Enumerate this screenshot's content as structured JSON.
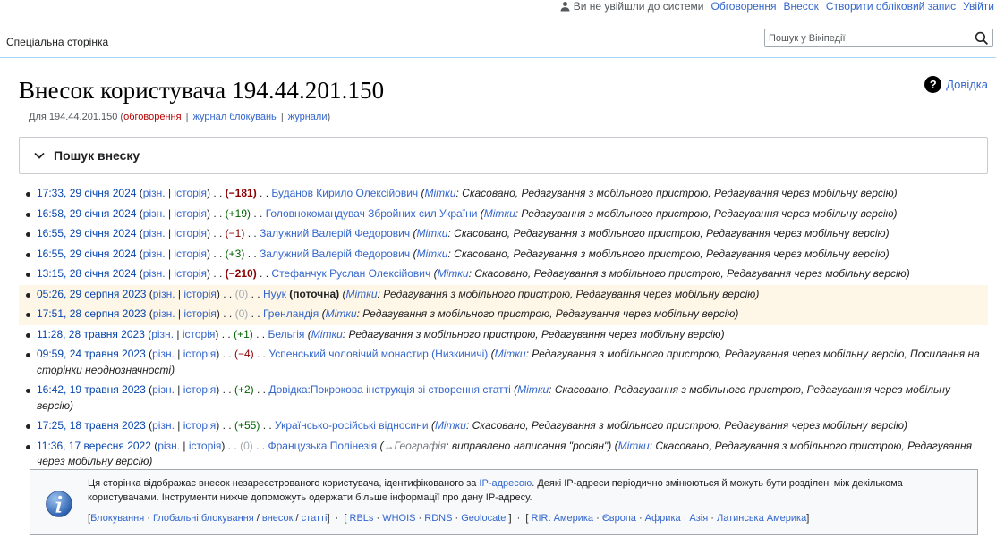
{
  "personal": {
    "anon": "Ви не увійшли до системи",
    "links": [
      "Обговорення",
      "Внесок",
      "Створити обліковий запис",
      "Увійти"
    ]
  },
  "tabs": {
    "special": "Спеціальна сторінка"
  },
  "search": {
    "placeholder": "Пошук у Вікіпедії"
  },
  "page": {
    "title": "Внесок користувача 194.44.201.150",
    "help": "Довідка",
    "sub_prefix": "Для 194.44.201.150 (",
    "sub_talk": "обговорення",
    "sub_block": "журнал блокувань",
    "sub_logs": "журнали",
    "sub_suffix": ")",
    "sep": "|"
  },
  "searchpanel": {
    "label": "Пошук внеску"
  },
  "contribs": [
    {
      "time": "17:33, 29 січня 2024",
      "diff": "різн.",
      "hist": "історія",
      "size": "(−181)",
      "size_class": "diff-neg-big",
      "page": "Буданов Кирило Олексійович",
      "current": "",
      "comment": "",
      "tags_label": "Мітки",
      "tags": "Скасовано, Редагування з мобільного пристрою, Редагування через мобільну версію"
    },
    {
      "time": "16:58, 29 січня 2024",
      "diff": "різн.",
      "hist": "історія",
      "size": "(+19)",
      "size_class": "diff-pos",
      "page": "Головнокомандувач Збройних сил України",
      "current": "",
      "comment": "",
      "tags_label": "Мітки",
      "tags": "Редагування з мобільного пристрою, Редагування через мобільну версію"
    },
    {
      "time": "16:55, 29 січня 2024",
      "diff": "різн.",
      "hist": "історія",
      "size": "(−1)",
      "size_class": "diff-neg",
      "page": "Залужний Валерій Федорович",
      "current": "",
      "comment": "",
      "tags_label": "Мітки",
      "tags": "Скасовано, Редагування з мобільного пристрою, Редагування через мобільну версію"
    },
    {
      "time": "16:55, 29 січня 2024",
      "diff": "різн.",
      "hist": "історія",
      "size": "(+3)",
      "size_class": "diff-pos",
      "page": "Залужний Валерій Федорович",
      "current": "",
      "comment": "",
      "tags_label": "Мітки",
      "tags": "Скасовано, Редагування з мобільного пристрою, Редагування через мобільну версію"
    },
    {
      "time": "13:15, 28 січня 2024",
      "diff": "різн.",
      "hist": "історія",
      "size": "(−210)",
      "size_class": "diff-neg-big",
      "page": "Стефанчук Руслан Олексійович",
      "current": "",
      "comment": "",
      "tags_label": "Мітки",
      "tags": "Скасовано, Редагування з мобільного пристрою, Редагування через мобільну версію"
    },
    {
      "time": "05:26, 29 серпня 2023",
      "diff": "різн.",
      "hist": "історія",
      "size": "(0)",
      "size_class": "diff-zero",
      "page": "Нуук",
      "current": "(поточна)",
      "comment": "",
      "tags_label": "Мітки",
      "tags": "Редагування з мобільного пристрою, Редагування через мобільну версію",
      "highlight": true
    },
    {
      "time": "17:51, 28 серпня 2023",
      "diff": "різн.",
      "hist": "історія",
      "size": "(0)",
      "size_class": "diff-zero",
      "page": "Гренландія",
      "current": "",
      "comment": "",
      "tags_label": "Мітки",
      "tags": "Редагування з мобільного пристрою, Редагування через мобільну версію",
      "highlight": true
    },
    {
      "time": "11:28, 28 травня 2023",
      "diff": "різн.",
      "hist": "історія",
      "size": "(+1)",
      "size_class": "diff-pos",
      "page": "Бельгія",
      "current": "",
      "comment": "",
      "tags_label": "Мітки",
      "tags": "Редагування з мобільного пристрою, Редагування через мобільну версію"
    },
    {
      "time": "09:59, 24 травня 2023",
      "diff": "різн.",
      "hist": "історія",
      "size": "(−4)",
      "size_class": "diff-neg",
      "page": "Успенський чоловічий монастир (Низкиничі)",
      "current": "",
      "comment": "",
      "tags_label": "Мітки",
      "tags": "Редагування з мобільного пристрою, Редагування через мобільну версію, Посилання на сторінки неоднозначності"
    },
    {
      "time": "16:42, 19 травня 2023",
      "diff": "різн.",
      "hist": "історія",
      "size": "(+2)",
      "size_class": "diff-pos",
      "page": "Довідка:Покрокова інструкція зі створення статті",
      "current": "",
      "comment": "",
      "tags_label": "Мітки",
      "tags": "Скасовано, Редагування з мобільного пристрою, Редагування через мобільну версію"
    },
    {
      "time": "17:25, 18 травня 2023",
      "diff": "різн.",
      "hist": "історія",
      "size": "(+55)",
      "size_class": "diff-pos",
      "page": "Українсько-російські відносини",
      "current": "",
      "comment": "",
      "tags_label": "Мітки",
      "tags": "Скасовано, Редагування з мобільного пристрою, Редагування через мобільну версію"
    },
    {
      "time": "11:36, 17 вересня 2022",
      "diff": "різн.",
      "hist": "історія",
      "size": "(0)",
      "size_class": "diff-zero",
      "page": "Французька Полінезія",
      "current": "",
      "comment_arrow": "→Географія",
      "comment": ": виправлено написання \"росіян\"",
      "tags_label": "Мітки",
      "tags": "Скасовано, Редагування з мобільного пристрою, Редагування через мобільну версію"
    }
  ],
  "common": {
    "dots": ". .",
    "sepbar": "|"
  },
  "infobox": {
    "text1": "Ця сторінка відображає внесок незареєстрованого користувача, ідентифікованого за ",
    "ip_link": "IP-адресою",
    "text2": ". Деякі IP-адреси періодично змінюються й можуть бути розділені між декількома користувачами. Інструменти нижче допоможуть одержати більше інформації про дану IP-адресу.",
    "tools": {
      "block": "Блокування",
      "global_block": "Глобальні блокування",
      "contribs": "внесок",
      "articles": "статті",
      "rbls": "RBLs",
      "whois": "WHOIS",
      "rdns": "RDNS",
      "geolocate": "Geolocate",
      "rir": "RIR",
      "america": "Америка",
      "europe": "Європа",
      "africa": "Африка",
      "asia": "Азія",
      "latam": "Латинська Америка"
    }
  },
  "colors": {
    "link": "#3366cc",
    "highlight": "#fef6e7",
    "border": "#a7d7f9",
    "pos": "#006400",
    "neg": "#8b0000"
  }
}
